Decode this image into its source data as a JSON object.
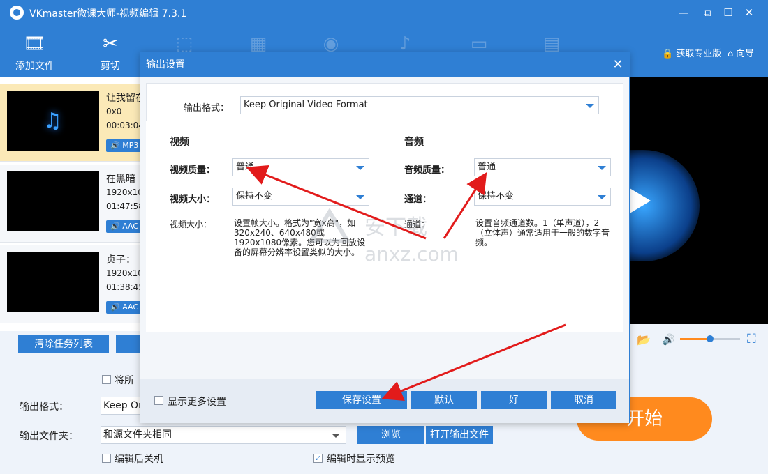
{
  "app": {
    "title": "VKmaster微课大师-视频编辑 7.3.1",
    "minimize": "—",
    "maximize": "☐",
    "close": "✕"
  },
  "toolbar": {
    "add_file": "添加文件",
    "cut": "剪切",
    "get_pro": "获取专业版",
    "guide": "向导"
  },
  "files": [
    {
      "name": "让我留在",
      "resolution": "0x0",
      "duration": "00:03:04",
      "badge": "MP3"
    },
    {
      "name": "在黑暗",
      "resolution": "1920x10",
      "duration": "01:47:58",
      "badge": "AAC"
    },
    {
      "name": "贞子：",
      "resolution": "1920x10",
      "duration": "01:38:45",
      "badge": "AAC"
    }
  ],
  "clear_list": "清除任务列表",
  "bottom": {
    "merge_label": "将所",
    "output_format_label": "输出格式：",
    "output_format_value": "Keep Or",
    "output_folder_label": "输出文件夹：",
    "output_folder_value": "和源文件夹相同",
    "browse": "浏览",
    "open_output": "打开输出文件",
    "shutdown_after": "编辑后关机",
    "show_preview": "编辑时显示预览",
    "start": "开始"
  },
  "dialog": {
    "title": "输出设置",
    "format_label": "输出格式：",
    "format_value": "Keep Original Video Format",
    "video": {
      "heading": "视频",
      "quality_label": "视频质量：",
      "quality_value": "普通",
      "size_label": "视频大小：",
      "size_value": "保持不变",
      "desc_label": "视频大小：",
      "desc_text": "设置帧大小。格式为\"宽x高\"，如320x240、640x480或1920x1080像素。您可以为回放设备的屏幕分辨率设置类似的大小。"
    },
    "audio": {
      "heading": "音频",
      "quality_label": "音频质量：",
      "quality_value": "普通",
      "channel_label": "通道：",
      "channel_value": "保持不变",
      "desc_label": "通道：",
      "desc_text": "设置音频通道数。1（单声道），2（立体声）通常适用于一般的数字音频。"
    },
    "more_settings": "显示更多设置",
    "save": "保存设置",
    "default": "默认",
    "ok": "好",
    "cancel": "取消"
  },
  "watermark": "anxz.com",
  "colors": {
    "accent": "#2f7fd4",
    "start": "#ff8a1e",
    "arrow": "#e21b1b"
  }
}
